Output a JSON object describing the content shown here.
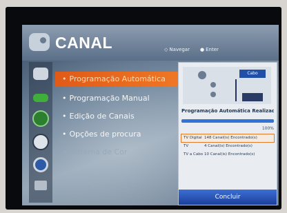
{
  "header": {
    "title": "CANAL",
    "nav_hint_glyph": "◇",
    "nav_hint": "Navegar",
    "enter_hint_glyph": "●",
    "enter_hint": "Enter"
  },
  "sidebar": {
    "icons": [
      "picture-icon",
      "audio-icon",
      "channel-icon",
      "time-icon",
      "options-icon",
      "input-icon"
    ]
  },
  "menu": {
    "bullet": "•",
    "items": [
      {
        "label": "Programação Automática",
        "selected": true
      },
      {
        "label": "Programação Manual"
      },
      {
        "label": "Edição de Canais"
      },
      {
        "label": "Opções de procura"
      },
      {
        "label": "Sistema de Cor",
        "disabled": true
      }
    ]
  },
  "popup": {
    "cable_label": "Cabo",
    "status": "Programação Automática Realizada.",
    "progress_percent": 100,
    "progress_text": "100%",
    "results": [
      {
        "source": "TV Digital",
        "text": "148 Canal(is) Encontrado(s)"
      },
      {
        "source": "TV",
        "text": "4 Canal(is) Encontrado(s)"
      },
      {
        "source": "TV a Cabo",
        "text": "10 Canal(is) Encontrado(s)"
      }
    ],
    "done_button": "Concluir"
  },
  "colors": {
    "selection": "#f07a26",
    "button": "#2f5fc4",
    "progress": "#2f74d6"
  }
}
